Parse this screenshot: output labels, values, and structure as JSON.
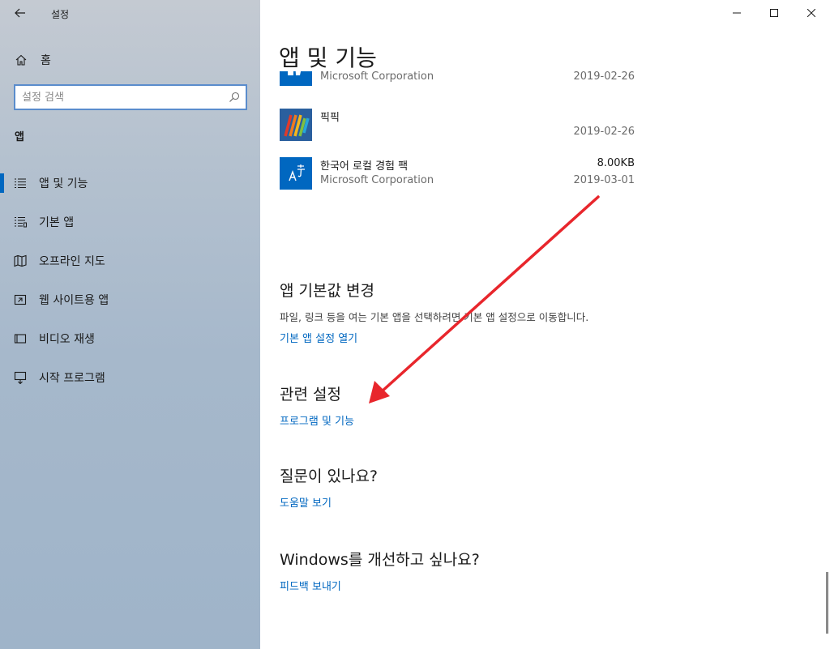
{
  "window": {
    "title": "설정",
    "controls": {
      "minimize": "minimize",
      "maximize": "maximize",
      "close": "close"
    }
  },
  "sidebar": {
    "home_label": "홈",
    "search_placeholder": "설정 검색",
    "section_label": "앱",
    "items": [
      {
        "label": "앱 및 기능",
        "icon": "list-icon",
        "selected": true
      },
      {
        "label": "기본 앱",
        "icon": "default-apps-icon",
        "selected": false
      },
      {
        "label": "오프라인 지도",
        "icon": "map-icon",
        "selected": false
      },
      {
        "label": "웹 사이트용 앱",
        "icon": "link-window-icon",
        "selected": false
      },
      {
        "label": "비디오 재생",
        "icon": "video-icon",
        "selected": false
      },
      {
        "label": "시작 프로그램",
        "icon": "startup-icon",
        "selected": false
      }
    ]
  },
  "main": {
    "title": "앱 및 기능",
    "apps": [
      {
        "name": "",
        "publisher": "Microsoft Corporation",
        "size": "",
        "date": "2019-02-26",
        "icon": "white-glyph-app-icon",
        "icon_color": "#0067c0"
      },
      {
        "name": "픽픽",
        "publisher": "",
        "size": "",
        "date": "2019-02-26",
        "icon": "picpick-icon",
        "icon_color": "#2a5f9e"
      },
      {
        "name": "한국어 로컬 경험 팩",
        "publisher": "Microsoft Corporation",
        "size": "8.00KB",
        "date": "2019-03-01",
        "icon": "language-pack-icon",
        "icon_color": "#0067c0"
      }
    ],
    "default_apps": {
      "heading": "앱 기본값 변경",
      "description": "파일, 링크 등을 여는 기본 앱을 선택하려면 기본 앱 설정으로 이동합니다.",
      "link": "기본 앱 설정 열기"
    },
    "related": {
      "heading": "관련 설정",
      "link": "프로그램 및 기능"
    },
    "help": {
      "heading": "질문이 있나요?",
      "link": "도움말 보기"
    },
    "feedback": {
      "heading": "Windows를 개선하고 싶나요?",
      "link": "피드백 보내기"
    }
  },
  "colors": {
    "accent": "#0067c0",
    "annotation_arrow": "#e8262c"
  }
}
